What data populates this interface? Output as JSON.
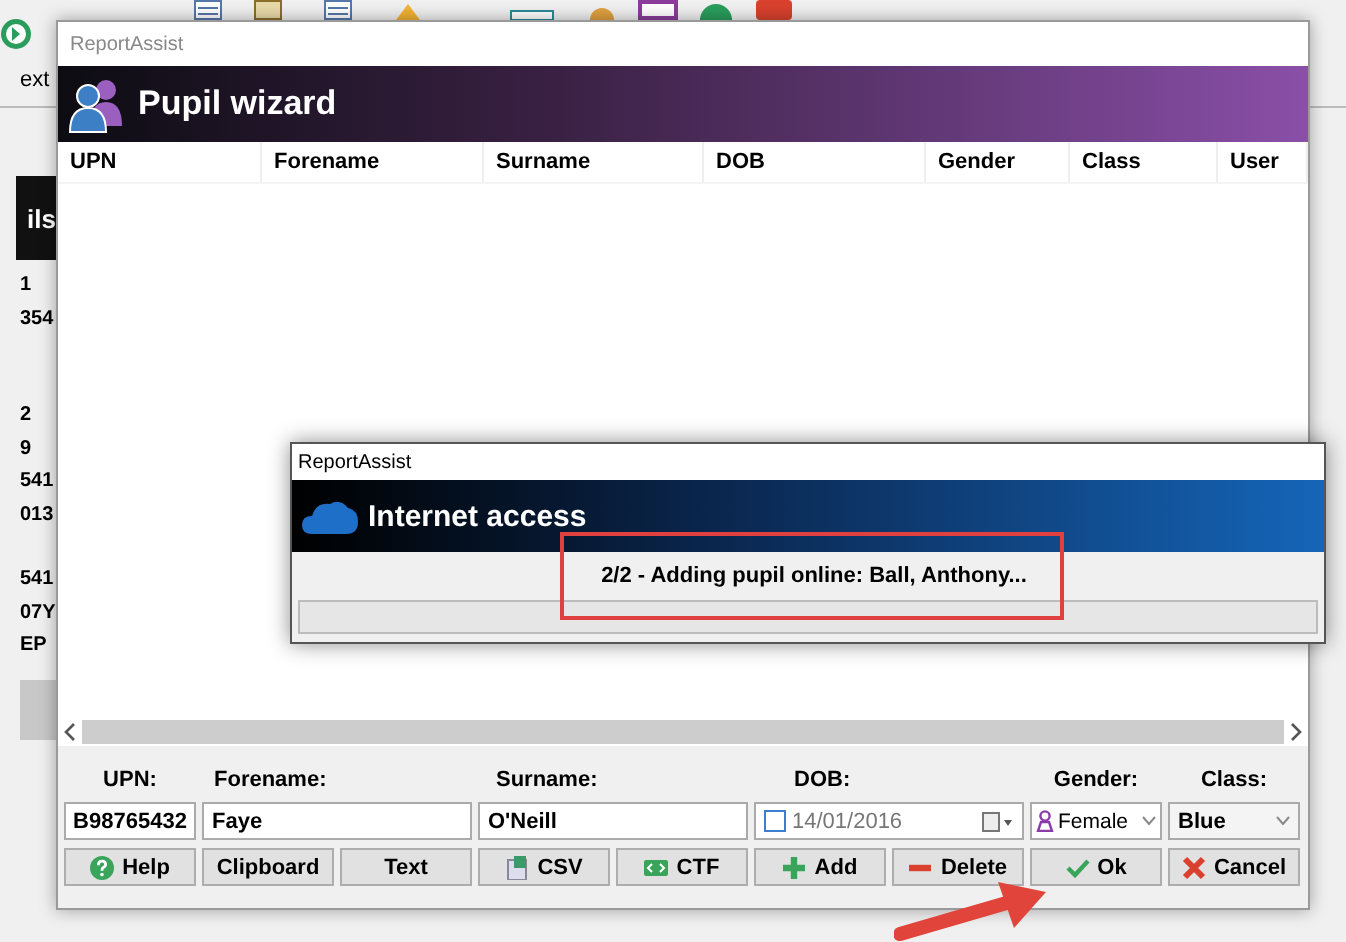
{
  "background_app": {
    "toolbar_label": "ext",
    "header_text": "ils",
    "list": [
      "1",
      "354",
      "2",
      "9",
      "541",
      "013",
      "541",
      "07Y",
      "EP"
    ]
  },
  "pupil_wizard": {
    "window_title": "ReportAssist",
    "title": "Pupil wizard",
    "columns": [
      "UPN",
      "Forename",
      "Surname",
      "DOB",
      "Gender",
      "Class",
      "User"
    ],
    "form": {
      "upn": {
        "label": "UPN:",
        "value": "B98765432"
      },
      "forename": {
        "label": "Forename:",
        "value": "Faye"
      },
      "surname": {
        "label": "Surname:",
        "value": "O'Neill"
      },
      "dob": {
        "label": "DOB:",
        "value": "14/01/2016",
        "checked": false
      },
      "gender": {
        "label": "Gender:",
        "value": "Female"
      },
      "class": {
        "label": "Class:",
        "value": "Blue"
      }
    },
    "buttons": [
      {
        "label": "Help",
        "kind": "help"
      },
      {
        "label": "Clipboard",
        "kind": "plain"
      },
      {
        "label": "Text",
        "kind": "plain"
      },
      {
        "label": "CSV",
        "kind": "csv"
      },
      {
        "label": "CTF",
        "kind": "ctf"
      },
      {
        "label": "Add",
        "kind": "add"
      },
      {
        "label": "Delete",
        "kind": "delete"
      },
      {
        "label": "Ok",
        "kind": "ok"
      },
      {
        "label": "Cancel",
        "kind": "cancel"
      }
    ]
  },
  "progress_dialog": {
    "window_title": "ReportAssist",
    "title": "Internet access",
    "message": "2/2 - Adding pupil online: Ball, Anthony...",
    "progress": {
      "level": 0
    }
  }
}
